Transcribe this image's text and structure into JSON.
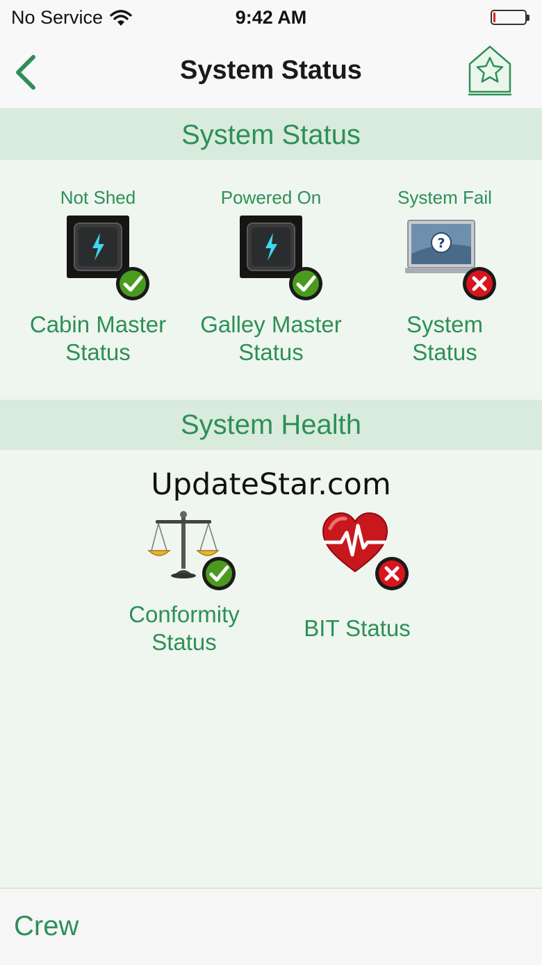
{
  "status_bar": {
    "carrier": "No Service",
    "time": "9:42 AM",
    "battery_level_percent": 5,
    "battery_color": "#e02020"
  },
  "nav": {
    "title": "System Status",
    "back_icon": "chevron-left-icon",
    "favorite_icon": "star-icon"
  },
  "sections": {
    "status_header": "System Status",
    "health_header": "System Health"
  },
  "status_tiles": [
    {
      "state": "Not Shed",
      "label_line1": "Cabin Master",
      "label_line2": "Status",
      "icon": "power-button-icon",
      "badge": "ok"
    },
    {
      "state": "Powered On",
      "label_line1": "Galley Master",
      "label_line2": "Status",
      "icon": "power-button-icon",
      "badge": "ok"
    },
    {
      "state": "System Fail",
      "label_line1": "System",
      "label_line2": "Status",
      "icon": "laptop-question-icon",
      "badge": "fail"
    }
  ],
  "health_tiles": [
    {
      "label_line1": "Conformity",
      "label_line2": "Status",
      "icon": "scales-icon",
      "badge": "ok"
    },
    {
      "label_line1": "BIT Status",
      "icon": "heart-pulse-icon",
      "badge": "fail"
    }
  ],
  "watermark": "UpdateStar.com",
  "tab_bar": {
    "crew_label": "Crew"
  },
  "colors": {
    "accent": "#2e8f57",
    "header_bg": "#d8ebdc",
    "page_bg": "#eef6ef",
    "ok": "#4a9a1e",
    "fail": "#d8141c"
  }
}
